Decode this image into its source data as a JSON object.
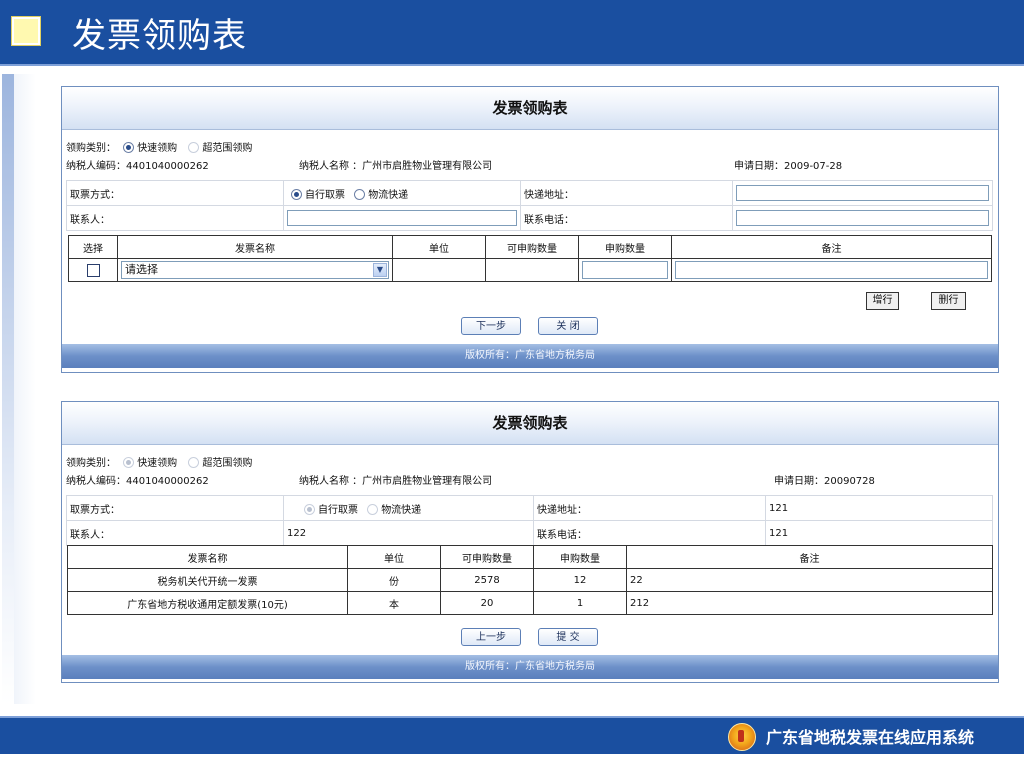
{
  "slide_title": "发票领购表",
  "footer_brand": "广东省地税发票在线应用系统",
  "form1": {
    "title": "发票领购表",
    "purchase_type_label": "领购类别：",
    "purchase_type_options": [
      "快速领购",
      "超范围领购"
    ],
    "taxpayer_id_label": "纳税人编码：4401040000262",
    "taxpayer_name_label": "纳税人名称 ：广州市启胜物业管理有限公司",
    "apply_date_label": "申请日期：2009-07-28",
    "pickup_method_label": "取票方式：",
    "pickup_options": [
      "自行取票",
      "物流快递"
    ],
    "express_address_label": "快递地址：",
    "contact_label": "联系人：",
    "contact_phone_label": "联系电话：",
    "table_headers": [
      "选择",
      "发票名称",
      "单位",
      "可申购数量",
      "申购数量",
      "备注"
    ],
    "select_placeholder": "请选择",
    "add_row": "增行",
    "delete_row": "删行",
    "next_button": "下一步",
    "close_button": "关 闭",
    "copyright": "版权所有：广东省地方税务局"
  },
  "form2": {
    "title": "发票领购表",
    "purchase_type_label": "领购类别：",
    "purchase_type_options": [
      "快速领购",
      "超范围领购"
    ],
    "taxpayer_id_label": "纳税人编码：4401040000262",
    "taxpayer_name_label": "纳税人名称 ：广州市启胜物业管理有限公司",
    "apply_date_label": "申请日期：20090728",
    "pickup_method_label": "取票方式：",
    "pickup_options": [
      "自行取票",
      "物流快递"
    ],
    "express_address_label": "快递地址：",
    "express_address_value": "121",
    "contact_label": "联系人：",
    "contact_value": "122",
    "contact_phone_label": "联系电话：",
    "contact_phone_value": "121",
    "table_headers": [
      "发票名称",
      "单位",
      "可申购数量",
      "申购数量",
      "备注"
    ],
    "rows": [
      {
        "name": "税务机关代开统一发票",
        "unit": "份",
        "available": "2578",
        "qty": "12",
        "note": "22"
      },
      {
        "name": "广东省地方税收通用定额发票(10元)",
        "unit": "本",
        "available": "20",
        "qty": "1",
        "note": "212"
      }
    ],
    "prev_button": "上一步",
    "submit_button": "提 交",
    "copyright": "版权所有：广东省地方税务局"
  }
}
